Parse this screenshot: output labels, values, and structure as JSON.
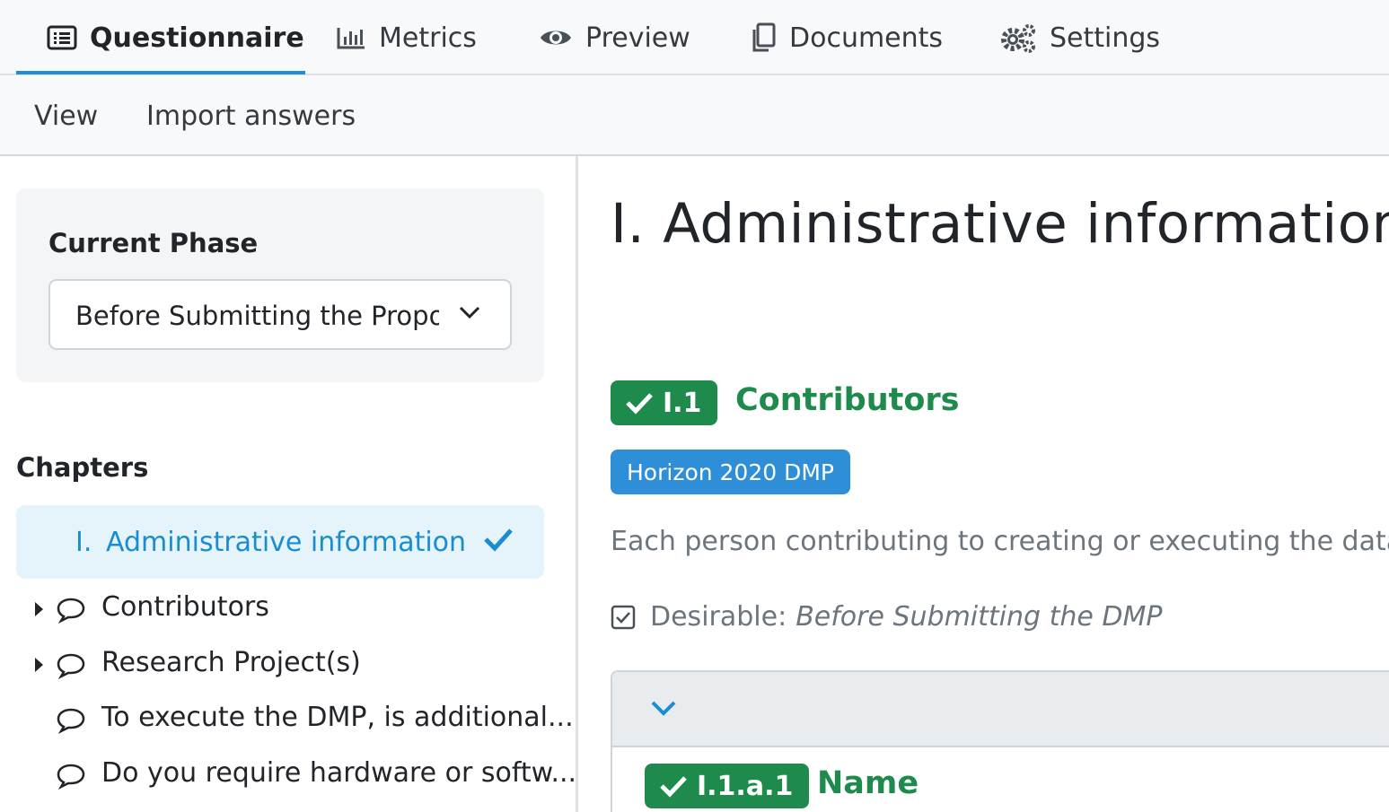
{
  "tabs": [
    {
      "label": "Questionnaire",
      "icon": "list-icon",
      "active": true
    },
    {
      "label": "Metrics",
      "icon": "bar-chart-icon"
    },
    {
      "label": "Preview",
      "icon": "eye-icon"
    },
    {
      "label": "Documents",
      "icon": "copy-icon"
    },
    {
      "label": "Settings",
      "icon": "gears-icon"
    }
  ],
  "subnav": {
    "view": "View",
    "import": "Import answers"
  },
  "sidebar": {
    "phase_title": "Current Phase",
    "phase_value": "Before Submitting the Proposal",
    "chapters_title": "Chapters",
    "active_chapter": {
      "number": "I.",
      "label": "Administrative information"
    },
    "items": [
      {
        "label": "Contributors"
      },
      {
        "label": "Research Project(s)"
      },
      {
        "label": "To execute the DMP, is additional..."
      },
      {
        "label": "Do you require hardware or softw..."
      }
    ]
  },
  "main": {
    "chapter_title": "I. Administrative information",
    "question": {
      "number": "I.1",
      "title": "Contributors",
      "tag": "Horizon 2020 DMP",
      "description": "Each person contributing to creating or executing the data ma",
      "desirable_label": "Desirable:",
      "desirable_value": "Before Submitting the DMP"
    },
    "sub_question": {
      "number": "I.1.a.1",
      "title": "Name"
    }
  },
  "colors": {
    "accent": "#1a8dd1",
    "success": "#1e8a4c",
    "tag": "#2e8fd8"
  }
}
